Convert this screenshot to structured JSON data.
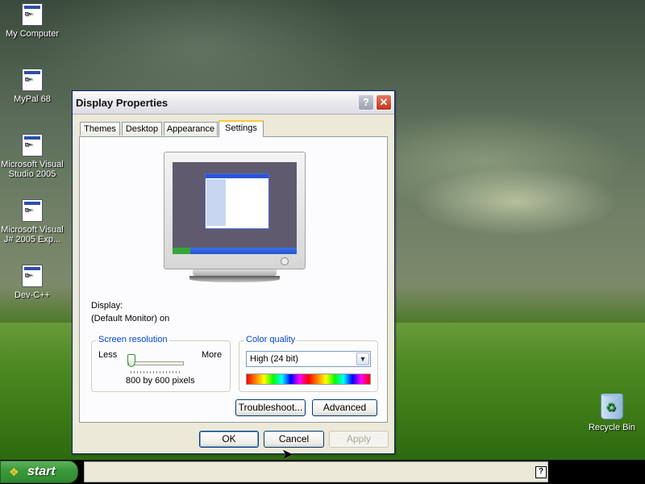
{
  "desktop": {
    "icons": [
      {
        "label": "My Computer"
      },
      {
        "label": "MyPal 68"
      },
      {
        "label": "Microsoft Visual Studio 2005"
      },
      {
        "label": "Microsoft Visual J# 2005 Exp..."
      },
      {
        "label": "Dev-C++"
      }
    ],
    "recycle_bin": {
      "label": "Recycle Bin"
    }
  },
  "window": {
    "title": "Display Properties",
    "help_glyph": "?",
    "close_glyph": "✕",
    "tabs": [
      {
        "label": "Themes"
      },
      {
        "label": "Desktop"
      },
      {
        "label": "Appearance"
      },
      {
        "label": "Settings"
      }
    ],
    "active_tab": "Settings",
    "display_label": "Display:",
    "display_value": "(Default Monitor) on",
    "screen_resolution": {
      "legend": "Screen resolution",
      "less": "Less",
      "more": "More",
      "value_text": "800 by 600 pixels",
      "slider_level": 0
    },
    "color_quality": {
      "legend": "Color quality",
      "selected": "High (24 bit)",
      "arrow": "▼"
    },
    "buttons": {
      "troubleshoot": "Troubleshoot...",
      "advanced": "Advanced",
      "ok": "OK",
      "cancel": "Cancel",
      "apply": "Apply"
    }
  },
  "taskbar": {
    "start_label": "start",
    "tray_glyph": "?"
  },
  "colors": {
    "title_active_close": "#c2331d",
    "group_legend": "#0046d5",
    "tab_highlight": "#ffc83c",
    "start_green": "#3c9a3c"
  }
}
